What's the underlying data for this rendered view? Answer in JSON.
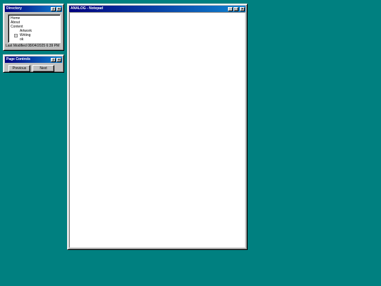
{
  "directory": {
    "title": "Directory",
    "title_buttons": [
      "?",
      "×"
    ],
    "tree": [
      "Home",
      "About",
      "Content"
    ],
    "tree_children": [
      {
        "expander": "",
        "label": "Artwork"
      },
      {
        "expander": "+",
        "label": "Writing"
      },
      {
        "expander": "",
        "label": "ok"
      }
    ],
    "status": "Last Modified 08/04/2025 6:39 PM"
  },
  "page_controls": {
    "title": "Page Controls",
    "title_buttons": [
      "?",
      "×"
    ],
    "previous_label": "Previous",
    "next_label": "Next"
  },
  "notepad": {
    "title": "ANALOG - Notepad",
    "title_buttons": [
      "_",
      "□",
      "×"
    ],
    "content": ""
  },
  "colors": {
    "desktop": "#008080",
    "titlebar_start": "#000080",
    "titlebar_end": "#1084d0",
    "window_face": "#c0c0c0"
  }
}
